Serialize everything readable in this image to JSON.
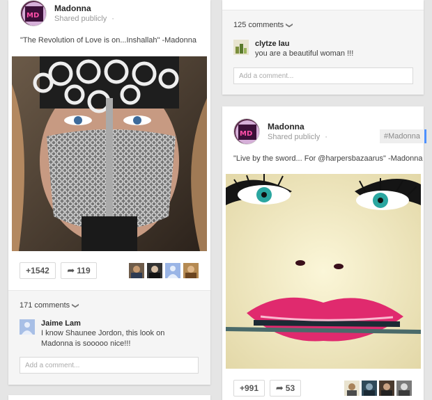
{
  "left_post": {
    "author": "Madonna",
    "visibility": "Shared publicly",
    "dot": "·",
    "text": "\"The Revolution of Love is on...Inshallah\" -Madonna",
    "plus_count": "+1542",
    "share_count": "119",
    "comments_count": "171 comments",
    "comment": {
      "author": "Jaime Lam",
      "text": "I know Shaunee Jordon, this look on Madonna is sooooo nice!!!"
    },
    "add_comment_placeholder": "Add a comment..."
  },
  "right_top": {
    "comments_count": "125 comments",
    "comment": {
      "author": "clytze lau",
      "text": "you are a beautiful woman !!!"
    },
    "add_comment_placeholder": "Add a comment..."
  },
  "right_post": {
    "author": "Madonna",
    "visibility": "Shared publicly",
    "dot": "·",
    "hashtag": "#Madonna",
    "text": "\"Live by the sword... For @harpersbazaarus\" -Madonna",
    "plus_count": "+991",
    "share_count": "53"
  },
  "icons": {
    "share": "share-arrow-icon",
    "chevron": "chevron-down-icon"
  },
  "colors": {
    "accent": "#4d90fe",
    "background": "#e5e5e5"
  }
}
